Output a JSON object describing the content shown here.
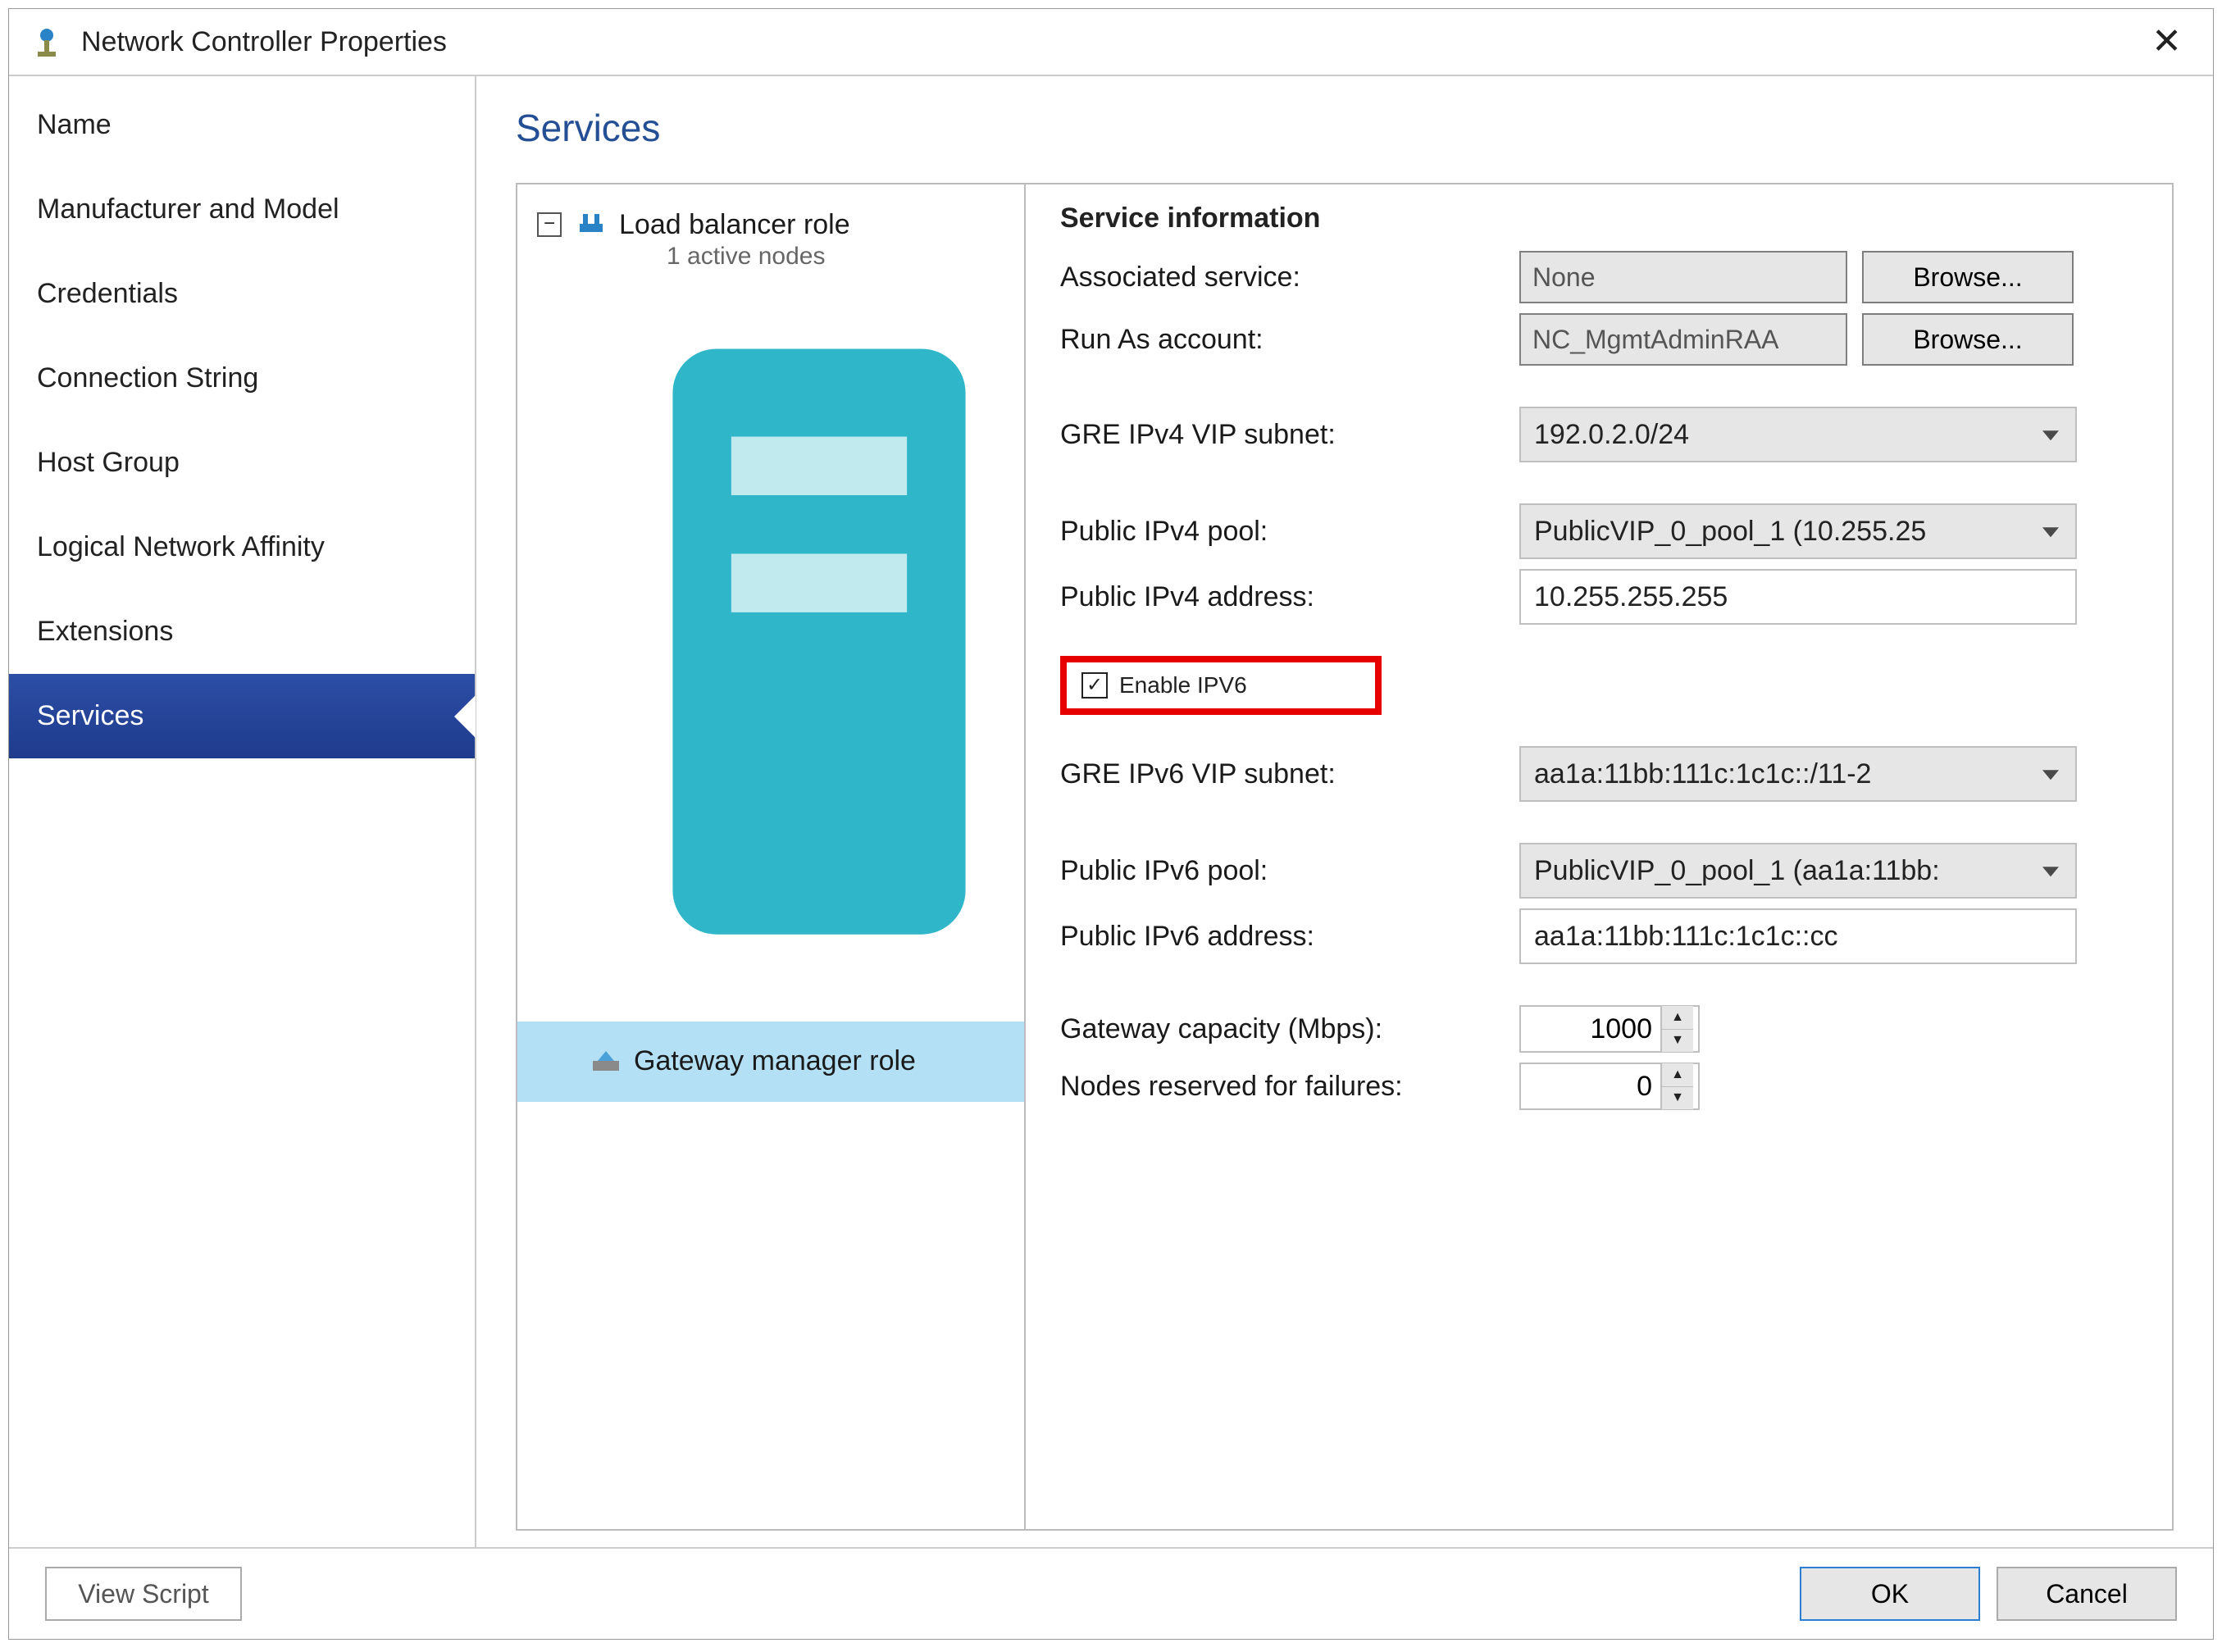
{
  "window": {
    "title": "Network Controller Properties",
    "close_glyph": "✕"
  },
  "sidebar": {
    "items": [
      {
        "label": "Name"
      },
      {
        "label": "Manufacturer and Model"
      },
      {
        "label": "Credentials"
      },
      {
        "label": "Connection String"
      },
      {
        "label": "Host Group"
      },
      {
        "label": "Logical Network Affinity"
      },
      {
        "label": "Extensions"
      },
      {
        "label": "Services"
      }
    ],
    "selected_index": 7
  },
  "page": {
    "title": "Services"
  },
  "tree": {
    "load_balancer": {
      "label": "Load balancer role",
      "subtitle": "1 active nodes"
    },
    "gateway_manager": {
      "label": "Gateway manager role"
    }
  },
  "details": {
    "section_title": "Service information",
    "associated_service": {
      "label": "Associated service:",
      "value": "None",
      "browse": "Browse..."
    },
    "run_as": {
      "label": "Run As account:",
      "value": "NC_MgmtAdminRAA",
      "browse": "Browse..."
    },
    "gre_ipv4_subnet": {
      "label": "GRE IPv4 VIP subnet:",
      "value": "192.0.2.0/24"
    },
    "public_ipv4_pool": {
      "label": "Public IPv4 pool:",
      "value": "PublicVIP_0_pool_1 (10.255.25"
    },
    "public_ipv4_addr": {
      "label": "Public IPv4 address:",
      "value": "10.255.255.255"
    },
    "enable_ipv6": {
      "label": "Enable IPV6",
      "checked": true
    },
    "gre_ipv6_subnet": {
      "label": "GRE IPv6 VIP subnet:",
      "value": "aa1a:11bb:111c:1c1c::/11-2"
    },
    "public_ipv6_pool": {
      "label": "Public IPv6 pool:",
      "value": "PublicVIP_0_pool_1 (aa1a:11bb:"
    },
    "public_ipv6_addr": {
      "label": "Public IPv6 address:",
      "value": "aa1a:11bb:111c:1c1c::cc"
    },
    "gateway_capacity": {
      "label": "Gateway capacity (Mbps):",
      "value": "1000"
    },
    "nodes_reserved": {
      "label": "Nodes reserved for failures:",
      "value": "0"
    }
  },
  "buttons": {
    "view_script": "View Script",
    "ok": "OK",
    "cancel": "Cancel"
  }
}
